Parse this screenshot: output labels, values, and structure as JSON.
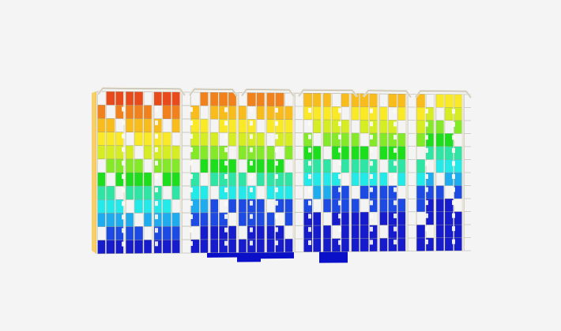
{
  "scene": {
    "background": "#f4f4f4",
    "frame_color": "#e8e4d8",
    "frame_edge": "#9a9a8a",
    "colormap": [
      "#0a10c8",
      "#1040e0",
      "#12a8ee",
      "#18e8e8",
      "#24e4a0",
      "#10dc10",
      "#7ce81c",
      "#d4ec18",
      "#fae81a",
      "#f8b810",
      "#f07a10",
      "#e84010"
    ],
    "stories": 12,
    "icon": "building-model-icon"
  }
}
